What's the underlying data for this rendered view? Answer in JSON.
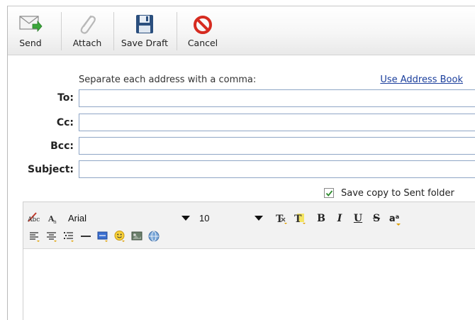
{
  "toolbar": {
    "send_label": "Send",
    "attach_label": "Attach",
    "save_draft_label": "Save Draft",
    "cancel_label": "Cancel"
  },
  "address": {
    "hint": "Separate each address with a comma:",
    "address_book_link": "Use Address Book",
    "to_label": "To:",
    "cc_label": "Cc:",
    "bcc_label": "Bcc:",
    "subject_label": "Subject:",
    "to_value": "",
    "cc_value": "",
    "bcc_value": "",
    "subject_value": ""
  },
  "save_copy": {
    "label": "Save copy to Sent folder",
    "checked": true
  },
  "editor": {
    "font_family": "Arial",
    "font_size": "10",
    "bold_glyph": "B",
    "italic_glyph": "I",
    "underline_glyph": "U",
    "strike_glyph": "S",
    "superscript_glyph": "a",
    "spell_icon_text": "Abc",
    "body": ""
  },
  "colors": {
    "link": "#1a3e9c",
    "field_border": "#8fa6c6",
    "cancel_red": "#d62b20",
    "send_green": "#3aa63a"
  },
  "icons": [
    "send-icon",
    "attach-icon",
    "save-draft-icon",
    "cancel-icon",
    "spellcheck-icon",
    "font-style-icon",
    "text-color-icon",
    "highlight-color-icon",
    "bold-icon",
    "italic-icon",
    "underline-icon",
    "strikethrough-icon",
    "superscript-icon",
    "align-left-icon",
    "align-center-icon",
    "list-icon",
    "horizontal-rule-icon",
    "insert-box-icon",
    "emoticon-icon",
    "image-icon",
    "insert-link-icon"
  ]
}
